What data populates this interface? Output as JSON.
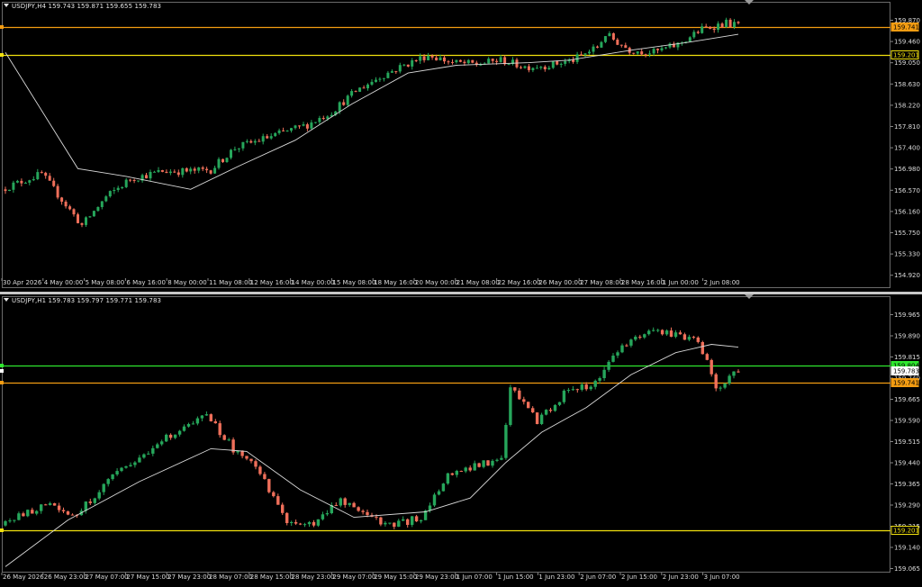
{
  "colors": {
    "bull": "#26a65b",
    "bear": "#ef6f5a",
    "bg": "#000000",
    "ma": "#d9d9d9",
    "orange": "#f39c12",
    "yellow": "#f1e10e",
    "green": "#2ee62e",
    "axis_text": "#dcdcdc"
  },
  "panes": [
    {
      "name": "top",
      "header": "USDJPY,H4  159.743 159.871 159.655 159.783",
      "y_ticks": [
        "159.870",
        "159.460",
        "159.050",
        "158.630",
        "158.220",
        "157.810",
        "157.400",
        "156.980",
        "156.570",
        "156.160",
        "155.750",
        "155.330",
        "154.920"
      ],
      "ymax": 159.88,
      "ymin": 154.88,
      "x_labels": [
        "30 Apr 2026",
        "4 May 00:00",
        "5 May 08:00",
        "6 May 16:00",
        "8 May 00:00",
        "11 May 08:00",
        "12 May 16:00",
        "14 May 00:00",
        "15 May 08:00",
        "18 May 16:00",
        "20 May 00:00",
        "21 May 08:00",
        "22 May 16:00",
        "26 May 00:00",
        "27 May 08:00",
        "28 May 16:00",
        "1 Jun 00:00",
        "2 Jun 08:00"
      ],
      "levels": [
        {
          "label": "159.741",
          "value": 159.741,
          "color": "orange",
          "style": "tag"
        },
        {
          "label": "159.201",
          "value": 159.201,
          "color": "yellow",
          "style": "box"
        }
      ],
      "key_points": [
        [
          0,
          156.6
        ],
        [
          10,
          156.9
        ],
        [
          14,
          156.5
        ],
        [
          20,
          155.9
        ],
        [
          26,
          156.45
        ],
        [
          32,
          156.8
        ],
        [
          40,
          156.95
        ],
        [
          47,
          156.95
        ],
        [
          52,
          156.98
        ],
        [
          58,
          157.4
        ],
        [
          64,
          157.55
        ],
        [
          70,
          157.7
        ],
        [
          76,
          157.85
        ],
        [
          82,
          158.1
        ],
        [
          88,
          158.5
        ],
        [
          94,
          158.78
        ],
        [
          100,
          159.0
        ],
        [
          106,
          159.2
        ],
        [
          112,
          159.05
        ],
        [
          118,
          159.02
        ],
        [
          124,
          159.1
        ],
        [
          130,
          158.97
        ],
        [
          136,
          159.0
        ],
        [
          142,
          159.1
        ],
        [
          148,
          159.35
        ],
        [
          150,
          159.6
        ],
        [
          156,
          159.3
        ],
        [
          162,
          159.25
        ],
        [
          168,
          159.4
        ],
        [
          174,
          159.7
        ],
        [
          180,
          159.82
        ],
        [
          182,
          159.78
        ]
      ],
      "candle_count": 183,
      "ma_points": [
        [
          0,
          159.25
        ],
        [
          18,
          157.0
        ],
        [
          30,
          156.85
        ],
        [
          46,
          156.6
        ],
        [
          58,
          157.05
        ],
        [
          72,
          157.55
        ],
        [
          86,
          158.25
        ],
        [
          100,
          158.85
        ],
        [
          112,
          159.0
        ],
        [
          130,
          159.05
        ],
        [
          140,
          159.1
        ],
        [
          156,
          159.3
        ],
        [
          170,
          159.45
        ],
        [
          182,
          159.6
        ]
      ]
    },
    {
      "name": "bottom",
      "header": "USDJPY,H1  159.783 159.797 159.771 159.783",
      "y_ticks": [
        "159.965",
        "159.890",
        "159.815",
        "159.740",
        "159.665",
        "159.590",
        "159.515",
        "159.440",
        "159.365",
        "159.290",
        "159.215",
        "159.140",
        "159.065"
      ],
      "ymax": 159.99,
      "ymin": 159.055,
      "x_labels": [
        "26 May 2026",
        "26 May 23:00",
        "27 May 07:00",
        "27 May 15:00",
        "27 May 23:00",
        "28 May 07:00",
        "28 May 15:00",
        "28 May 23:00",
        "29 May 07:00",
        "29 May 15:00",
        "29 May 23:00",
        "1 Jun 07:00",
        "1 Jun 15:00",
        "1 Jun 23:00",
        "2 Jun 07:00",
        "2 Jun 15:00",
        "2 Jun 23:00",
        "3 Jun 07:00"
      ],
      "levels": [
        {
          "label": "159.804",
          "value": 159.804,
          "color": "green",
          "style": "tag"
        },
        {
          "label": "159.783",
          "value": 159.783,
          "color": "white",
          "style": "tag"
        },
        {
          "label": "159.741",
          "value": 159.741,
          "color": "orange",
          "style": "tag"
        },
        {
          "label": "159.201",
          "value": 159.201,
          "color": "yellow",
          "style": "box"
        }
      ],
      "key_points": [
        [
          0,
          159.22
        ],
        [
          10,
          159.3
        ],
        [
          16,
          159.25
        ],
        [
          24,
          159.38
        ],
        [
          32,
          159.48
        ],
        [
          38,
          159.55
        ],
        [
          46,
          159.62
        ],
        [
          52,
          159.5
        ],
        [
          58,
          159.42
        ],
        [
          64,
          159.22
        ],
        [
          70,
          159.23
        ],
        [
          76,
          159.32
        ],
        [
          82,
          159.25
        ],
        [
          88,
          159.22
        ],
        [
          94,
          159.25
        ],
        [
          100,
          159.4
        ],
        [
          106,
          159.44
        ],
        [
          112,
          159.46
        ],
        [
          114,
          159.72
        ],
        [
          120,
          159.6
        ],
        [
          126,
          159.7
        ],
        [
          132,
          159.73
        ],
        [
          138,
          159.85
        ],
        [
          144,
          159.93
        ],
        [
          150,
          159.92
        ],
        [
          156,
          159.9
        ],
        [
          160,
          159.72
        ],
        [
          162,
          159.75
        ],
        [
          164,
          159.78
        ]
      ],
      "candle_count": 165,
      "ma_points": [
        [
          0,
          159.07
        ],
        [
          14,
          159.24
        ],
        [
          30,
          159.38
        ],
        [
          46,
          159.5
        ],
        [
          54,
          159.49
        ],
        [
          66,
          159.35
        ],
        [
          78,
          159.25
        ],
        [
          94,
          159.27
        ],
        [
          104,
          159.32
        ],
        [
          112,
          159.45
        ],
        [
          120,
          159.56
        ],
        [
          130,
          159.65
        ],
        [
          140,
          159.77
        ],
        [
          150,
          159.85
        ],
        [
          158,
          159.88
        ],
        [
          164,
          159.87
        ]
      ]
    }
  ]
}
